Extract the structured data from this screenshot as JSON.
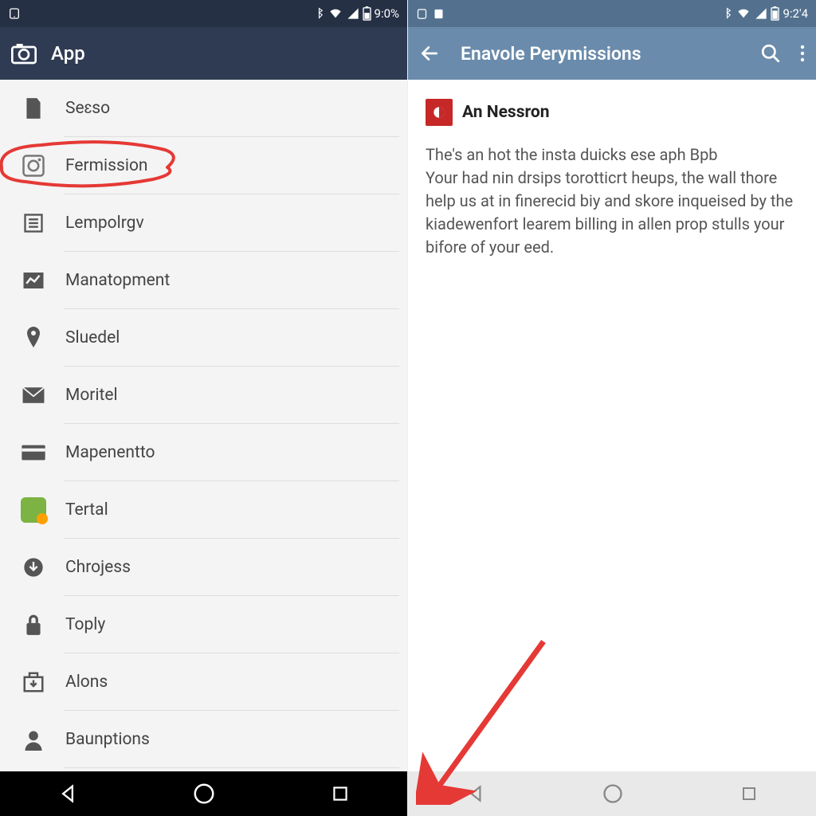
{
  "left": {
    "status": {
      "time": "9:0%"
    },
    "appbar": {
      "title": "App"
    },
    "items": [
      {
        "icon": "file-icon",
        "label": "Seɛso"
      },
      {
        "icon": "app-icon",
        "label": "Fermission"
      },
      {
        "icon": "list-icon",
        "label": "Lempolrgv"
      },
      {
        "icon": "chart-icon",
        "label": "Manatopment"
      },
      {
        "icon": "pin-icon",
        "label": "Sluedel"
      },
      {
        "icon": "mail-icon",
        "label": "Moritel"
      },
      {
        "icon": "card-icon",
        "label": "Mapenentto"
      },
      {
        "icon": "app-green-icon",
        "label": "Tertal"
      },
      {
        "icon": "download-icon",
        "label": "Chrojess"
      },
      {
        "icon": "lock-icon",
        "label": "Toply"
      },
      {
        "icon": "archive-icon",
        "label": "Alons"
      },
      {
        "icon": "person-icon",
        "label": "Baunptions"
      }
    ]
  },
  "right": {
    "status": {
      "time": "9:2'4"
    },
    "appbar": {
      "title": "Enavole Perymissions"
    },
    "detail": {
      "app_name": "An Nessron",
      "body": "The's an hot the insta duicks ese aph Bpb\nYour had nin drsips torotticrt heups, the wall thore help us at in finerecid biy and skore inqueised by the kiadewenfort learem billing in allen prop stulls your bifore of your eed."
    }
  }
}
